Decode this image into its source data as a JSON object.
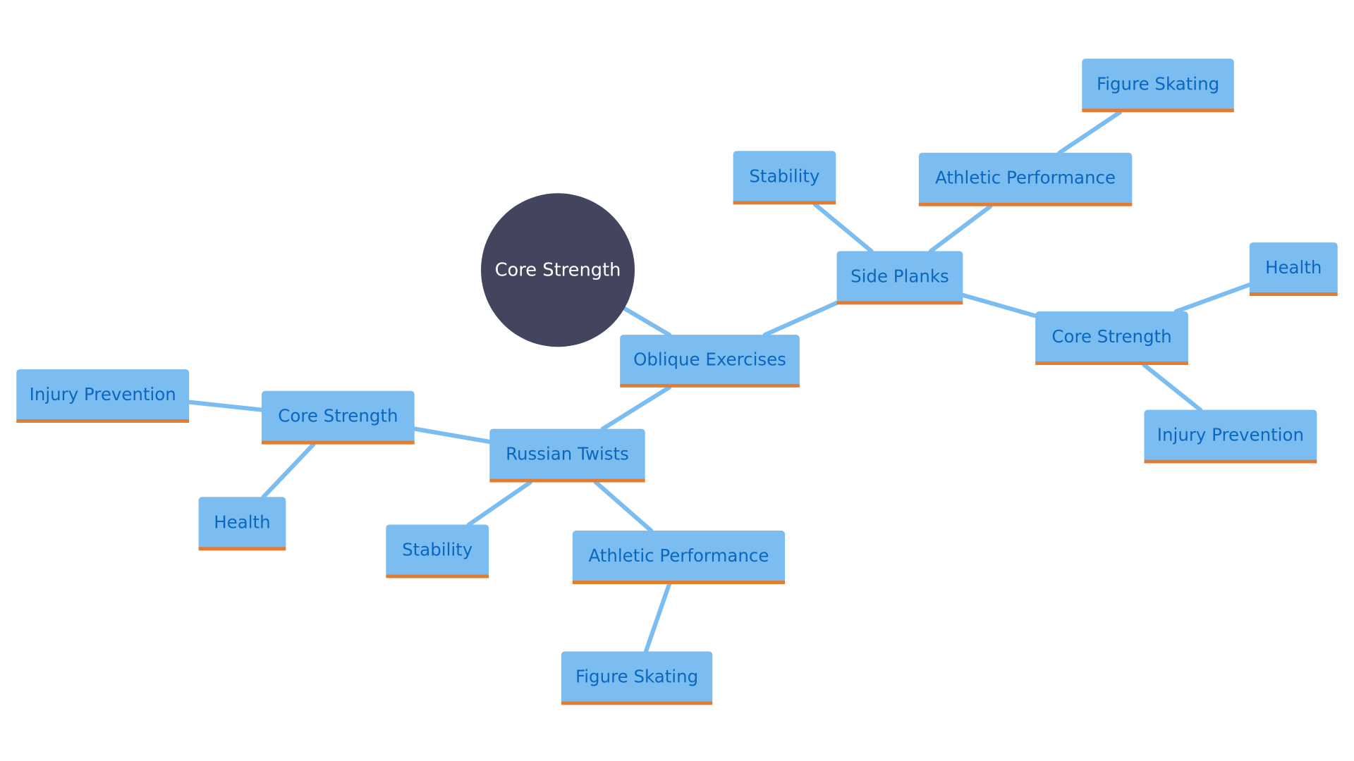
{
  "colors": {
    "root_fill": "#42455d",
    "root_text": "#ffffff",
    "node_fill": "#7bbdf0",
    "node_text": "#0b67bd",
    "node_underline": "#e37c2e",
    "edge": "#7bbdf0",
    "background": "#ffffff"
  },
  "root": {
    "id": "root",
    "label": "Core Strength"
  },
  "nodes": [
    {
      "id": "oblique",
      "label": "Oblique Exercises"
    },
    {
      "id": "sideplanks",
      "label": "Side Planks"
    },
    {
      "id": "sp_stability",
      "label": "Stability"
    },
    {
      "id": "sp_athletic",
      "label": "Athletic Performance"
    },
    {
      "id": "sp_figure",
      "label": "Figure Skating"
    },
    {
      "id": "sp_core",
      "label": "Core Strength"
    },
    {
      "id": "sp_health",
      "label": "Health"
    },
    {
      "id": "sp_injury",
      "label": "Injury Prevention"
    },
    {
      "id": "russian",
      "label": "Russian Twists"
    },
    {
      "id": "rt_core",
      "label": "Core Strength"
    },
    {
      "id": "rt_injury",
      "label": "Injury Prevention"
    },
    {
      "id": "rt_health",
      "label": "Health"
    },
    {
      "id": "rt_stability",
      "label": "Stability"
    },
    {
      "id": "rt_athletic",
      "label": "Athletic Performance"
    },
    {
      "id": "rt_figure",
      "label": "Figure Skating"
    }
  ],
  "edges": [
    [
      "root",
      "oblique"
    ],
    [
      "oblique",
      "sideplanks"
    ],
    [
      "sideplanks",
      "sp_stability"
    ],
    [
      "sideplanks",
      "sp_athletic"
    ],
    [
      "sp_athletic",
      "sp_figure"
    ],
    [
      "sideplanks",
      "sp_core"
    ],
    [
      "sp_core",
      "sp_health"
    ],
    [
      "sp_core",
      "sp_injury"
    ],
    [
      "oblique",
      "russian"
    ],
    [
      "russian",
      "rt_core"
    ],
    [
      "rt_core",
      "rt_injury"
    ],
    [
      "rt_core",
      "rt_health"
    ],
    [
      "russian",
      "rt_stability"
    ],
    [
      "russian",
      "rt_athletic"
    ],
    [
      "rt_athletic",
      "rt_figure"
    ]
  ]
}
